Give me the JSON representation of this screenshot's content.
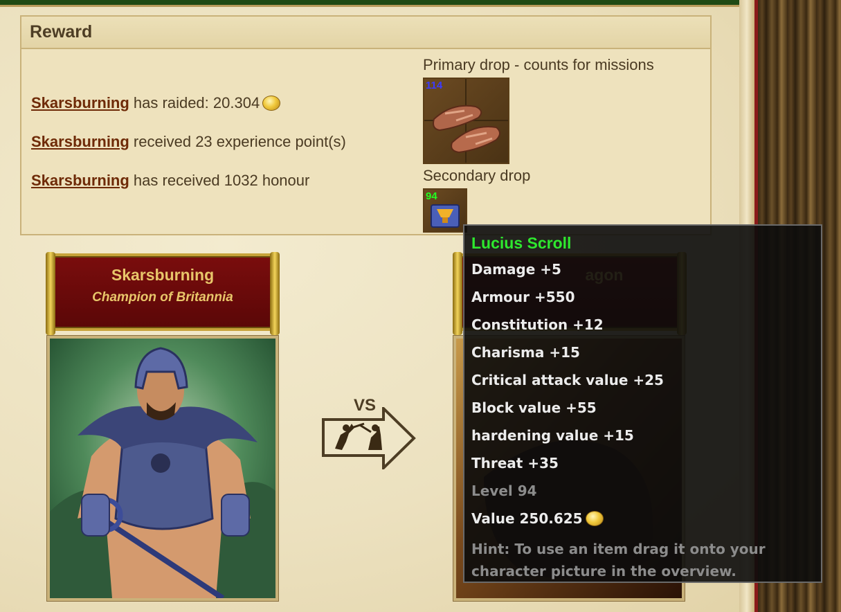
{
  "reward": {
    "title": "Reward",
    "player_name": "Skarsburning",
    "lines": [
      {
        "text": " has raided: 20.304",
        "icon": "gold-coin-icon"
      },
      {
        "text": " received 23 experience point(s)"
      },
      {
        "text": " has received 1032 honour"
      }
    ],
    "primary_drop_label": "Primary drop - counts for missions",
    "primary_item_level": "114",
    "secondary_drop_label": "Secondary drop",
    "secondary_item_level": "94",
    "colors": {
      "primary_level": "#3b3bff",
      "secondary_level": "#22ff22"
    }
  },
  "fighter": {
    "name": "Skarsburning",
    "title": "Champion of Britannia"
  },
  "opponent": {
    "name_partial": "agon"
  },
  "versus": {
    "label": "VS"
  },
  "tooltip": {
    "title": "Lucius Scroll",
    "title_color": "#2ee82e",
    "stats": [
      "Damage +5",
      "Armour +550",
      "Constitution +12",
      "Charisma +15",
      "Critical attack value +25",
      "Block value +55",
      "hardening value +15",
      "Threat +35"
    ],
    "level": "Level 94",
    "value": "Value 250.625",
    "hint": "Hint: To use an item drag it onto your character picture in the overview."
  }
}
